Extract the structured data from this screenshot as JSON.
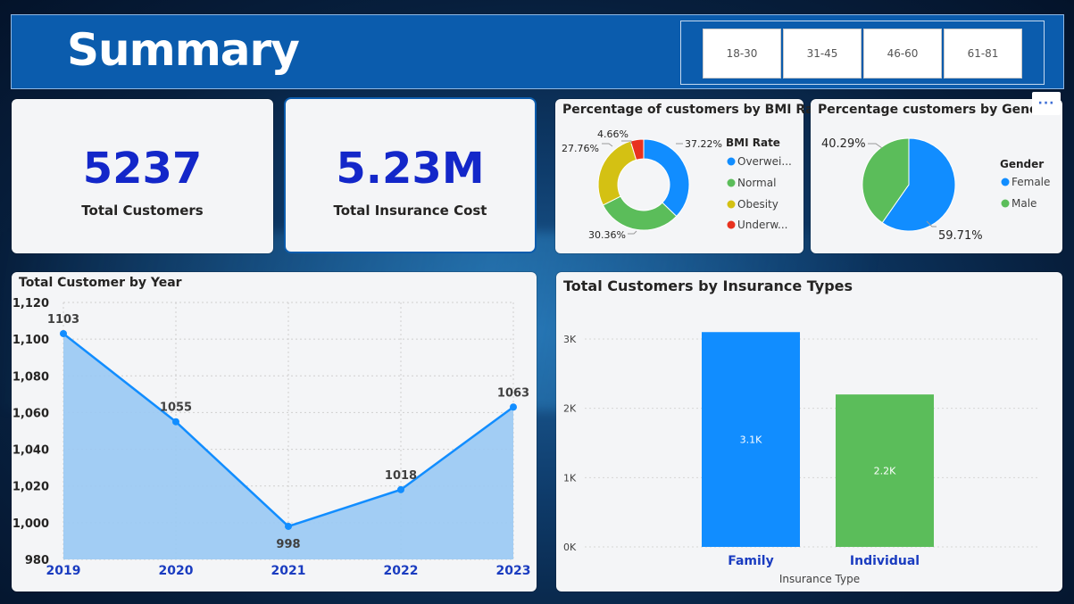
{
  "header": {
    "title": "Summary",
    "age_filters": [
      "18-30",
      "31-45",
      "46-60",
      "61-81"
    ]
  },
  "kpis": [
    {
      "value": "5237",
      "label": "Total Customers"
    },
    {
      "value": "5.23M",
      "label": "Total Insurance Cost"
    }
  ],
  "bmi_chart": {
    "title": "Percentage of customers by BMI Rate",
    "legend_title": "BMI Rate",
    "legend": [
      "Overwei...",
      "Normal",
      "Obesity",
      "Underw..."
    ],
    "labels": [
      "37.22%",
      "30.36%",
      "27.76%",
      "4.66%"
    ]
  },
  "gender_chart": {
    "title": "Percentage customers by Gender",
    "legend_title": "Gender",
    "legend": [
      "Female",
      "Male"
    ],
    "labels": [
      "59.71%",
      "40.29%"
    ]
  },
  "year_chart": {
    "title": "Total Customer by Year",
    "y_ticks": [
      "1,120",
      "1,100",
      "1,080",
      "1,060",
      "1,040",
      "1,020",
      "1,000",
      "980"
    ]
  },
  "insurance_chart": {
    "title": "Total Customers by Insurance Types",
    "xlabel": "Insurance Type",
    "y_ticks": [
      "3K",
      "2K",
      "1K",
      "0K"
    ],
    "data_labels": [
      "3.1K",
      "2.2K"
    ]
  },
  "more_options": "···",
  "colors": {
    "header_blue": "#0b5cad",
    "kpi_blue": "#1327c9",
    "overweight": "#118dff",
    "normal": "#5bbd5a",
    "obesity": "#d4c113",
    "underweight": "#e8321f",
    "line": "#118dff",
    "area": "#99c9f3"
  },
  "chart_data": [
    {
      "type": "pie",
      "title": "Percentage of customers by BMI Rate",
      "categories": [
        "Overwei...",
        "Normal",
        "Obesity",
        "Underw..."
      ],
      "values": [
        37.22,
        30.36,
        27.76,
        4.66
      ],
      "legend_position": "right"
    },
    {
      "type": "pie",
      "title": "Percentage customers by Gender",
      "categories": [
        "Female",
        "Male"
      ],
      "values": [
        59.71,
        40.29
      ],
      "legend_position": "right"
    },
    {
      "type": "area",
      "title": "Total Customer by Year",
      "x": [
        "2019",
        "2020",
        "2021",
        "2022",
        "2023"
      ],
      "values": [
        1103,
        1055,
        998,
        1018,
        1063
      ],
      "ylim": [
        980,
        1120
      ],
      "grid": true
    },
    {
      "type": "bar",
      "title": "Total Customers by Insurance Types",
      "categories": [
        "Family",
        "Individual"
      ],
      "values": [
        3100,
        2200
      ],
      "xlabel": "Insurance Type",
      "ylim": [
        0,
        3000
      ],
      "grid": true
    }
  ]
}
